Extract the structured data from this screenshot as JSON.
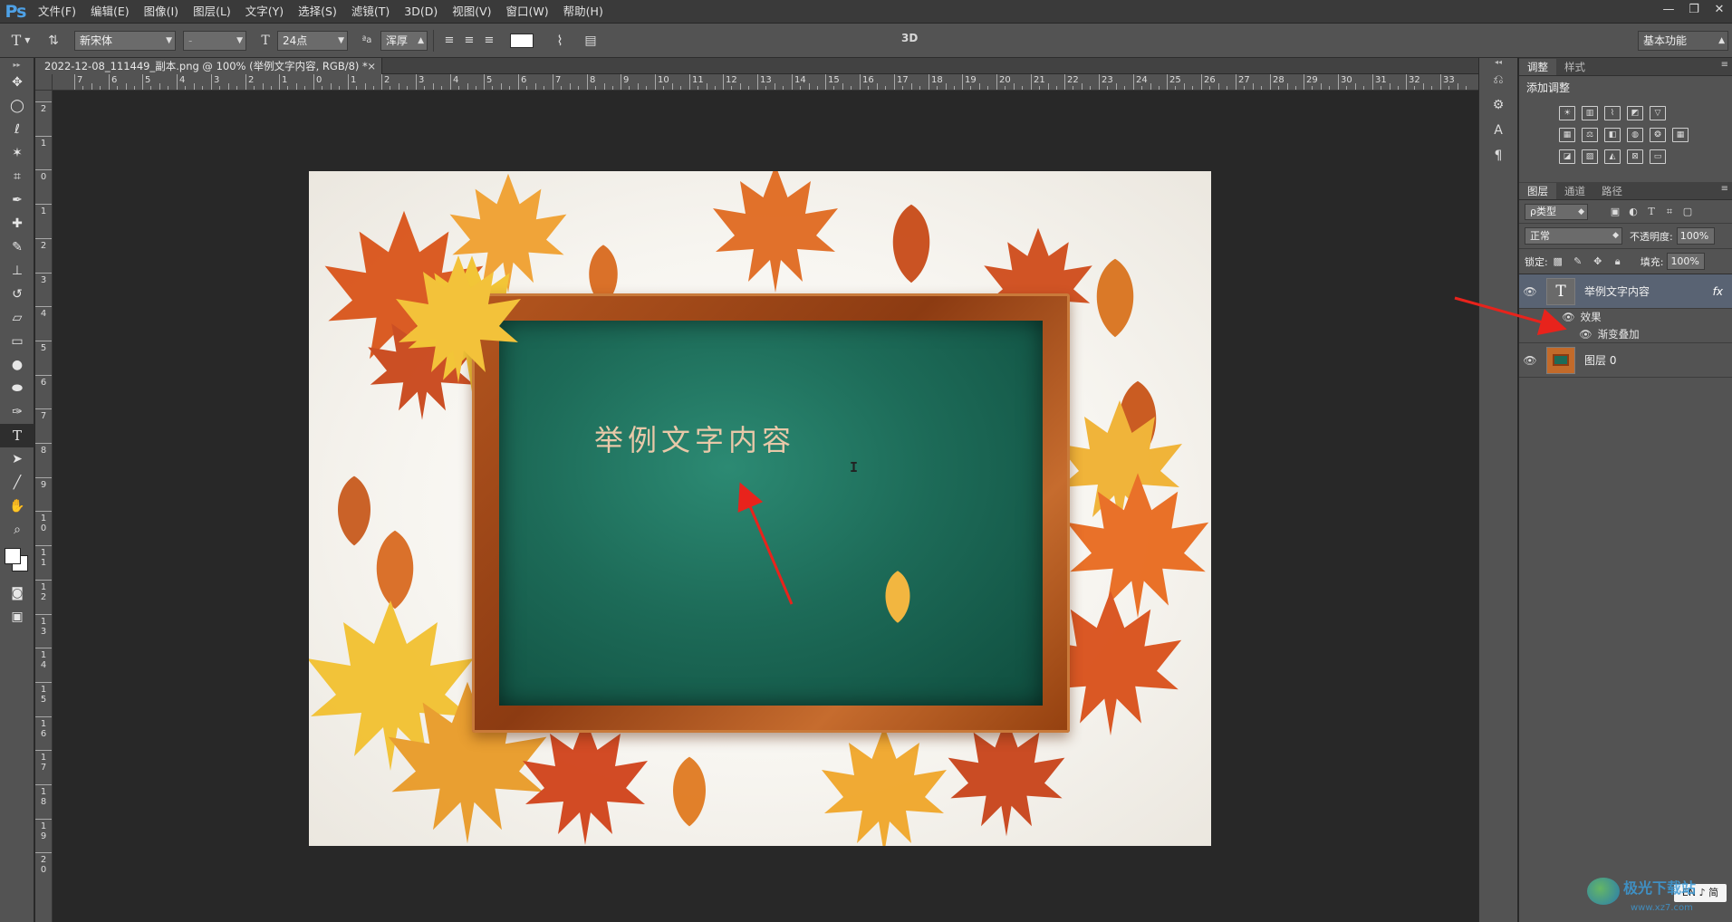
{
  "menubar": {
    "logo": "Ps",
    "items": [
      "文件(F)",
      "编辑(E)",
      "图像(I)",
      "图层(L)",
      "文字(Y)",
      "选择(S)",
      "滤镜(T)",
      "3D(D)",
      "视图(V)",
      "窗口(W)",
      "帮助(H)"
    ],
    "window_controls": [
      "—",
      "❐",
      "✕"
    ]
  },
  "options_bar": {
    "font_family": "新宋体",
    "font_style": "-",
    "font_size": "24点",
    "antialias": "浑厚",
    "label_3d": "3D",
    "workspace": "基本功能"
  },
  "document": {
    "tab_title": "2022-12-08_111449_副本.png @ 100% (举例文字内容, RGB/8) *",
    "close_glyph": "×",
    "board_text": "举例文字内容"
  },
  "rulers": {
    "h_labels": [
      "7",
      "6",
      "5",
      "4",
      "3",
      "2",
      "1",
      "0",
      "1",
      "2",
      "3",
      "4",
      "5",
      "6",
      "7",
      "8",
      "9",
      "10",
      "11",
      "12",
      "13",
      "14",
      "15",
      "16",
      "17",
      "18",
      "19",
      "20",
      "21",
      "22",
      "23",
      "24",
      "25",
      "26",
      "27",
      "28",
      "29",
      "30",
      "31",
      "32",
      "33"
    ],
    "v_labels": [
      "2",
      "1",
      "0",
      "1",
      "2",
      "3",
      "4",
      "5",
      "6",
      "7",
      "8",
      "9",
      "10",
      "11",
      "12",
      "13",
      "14",
      "15",
      "16",
      "17",
      "18",
      "19",
      "20"
    ]
  },
  "adjustments_panel": {
    "tabs": [
      "调整",
      "样式"
    ],
    "title": "添加调整"
  },
  "layers_panel": {
    "tabs": [
      "图层",
      "通道",
      "路径"
    ],
    "filter_kind": "ρ类型",
    "blend_mode": "正常",
    "opacity_label": "不透明度:",
    "opacity_value": "100%",
    "lock_label": "锁定:",
    "fill_label": "填充:",
    "fill_value": "100%",
    "layers": [
      {
        "name": "举例文字内容",
        "fx": "fx",
        "effects_label": "效果",
        "effect": "渐变叠加"
      },
      {
        "name": "图层 0"
      }
    ]
  },
  "taskbar": {
    "ime": "EN ♪ 简"
  },
  "watermark": {
    "text": "极光下载站",
    "url": "www.xz7.com"
  },
  "colors": {
    "accent_blue": "#4ea1e6",
    "arrow_red": "#e8231c",
    "board_green": "#1d6b58"
  }
}
